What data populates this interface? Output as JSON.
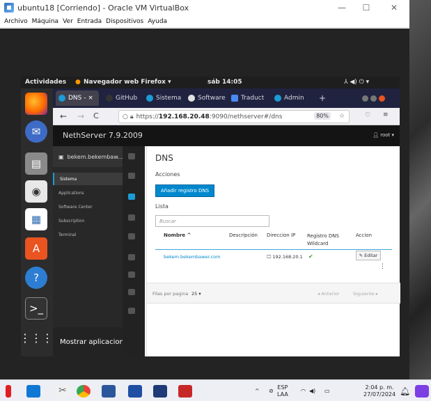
{
  "vbox": {
    "title": "ubuntu18 [Corriendo] - Oracle VM VirtualBox",
    "minimize": "—",
    "maximize": "☐",
    "close": "✕",
    "menu": [
      "Archivo",
      "Máquina",
      "Ver",
      "Entrada",
      "Dispositivos",
      "Ayuda"
    ]
  },
  "gnome": {
    "activities": "Actividades",
    "app_menu": "Navegador web Firefox ▾",
    "clock": "sáb 14:05",
    "tray": "⅄  ◀)  ⏻  ▾",
    "show_apps": "Mostrar aplicaciones"
  },
  "firefox": {
    "tabs": [
      "DNS - ×",
      "GitHub",
      "Sistema",
      "Software",
      "Traduct",
      "Admin"
    ],
    "new_tab": "+",
    "url_prefix": "https://",
    "url_host": "192.168.20.48",
    "url_rest": ":9090/nethserver#/dns",
    "zoom": "80%",
    "back": "←",
    "forward": "→",
    "reload": "C"
  },
  "nethserver": {
    "brand": "NethServer 7.9.2009",
    "user": "root ▾",
    "host": "bekem.bekembaw...",
    "nav": [
      "Sistema",
      "Applications",
      "Software Center",
      "Subscription",
      "Terminal"
    ]
  },
  "dns": {
    "title": "DNS",
    "actions_label": "Acciones",
    "add_button": "Añadir registro DNS",
    "list_label": "Lista",
    "search_placeholder": "Buscar",
    "columns": [
      "Nombre ^",
      "Descripción",
      "Direccion IP",
      "Registro DNS\nWildcard",
      "Accion"
    ],
    "row": {
      "name": "bekem.bekembawer.com",
      "description": "",
      "ip": "192.168.20.1",
      "wildcard": "✔",
      "action": "Editar",
      "more": "⋮"
    },
    "per_page_label": "Filas por pagina",
    "per_page_value": "25 ▾",
    "prev": "◂ Anterior",
    "next": "Siguiente ▸"
  },
  "taskbar": {
    "lang": "ESP",
    "lang_sub": "LAA",
    "time": "2:04 p. m.",
    "date": "27/07/2024"
  },
  "colors": {
    "accent": "#0088ce",
    "vbox_title_bg": "#ffffff",
    "firefox_tabbar": "#202340"
  }
}
